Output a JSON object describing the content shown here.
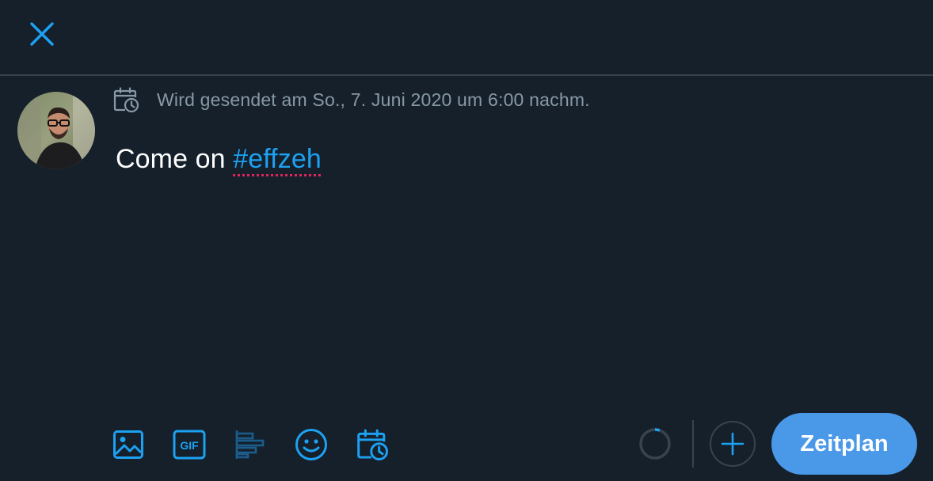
{
  "header": {
    "close_icon": "close-icon"
  },
  "composer": {
    "schedule_info": "Wird gesendet am So., 7. Juni 2020 um 6:00 nachm.",
    "text_before_hashtag": "Come on ",
    "hashtag": "#effzeh"
  },
  "toolbar": {
    "icons": [
      "image-icon",
      "gif-icon",
      "poll-icon",
      "emoji-icon",
      "schedule-icon"
    ],
    "gif_label": "GIF"
  },
  "actions": {
    "add_icon": "plus-icon",
    "submit_label": "Zeitplan"
  },
  "colors": {
    "background": "#15202b",
    "accent": "#1da1f2",
    "button": "#4a99e9",
    "muted_text": "#8899a6",
    "divider": "#38444d",
    "spellcheck_underline": "#e0245e"
  }
}
